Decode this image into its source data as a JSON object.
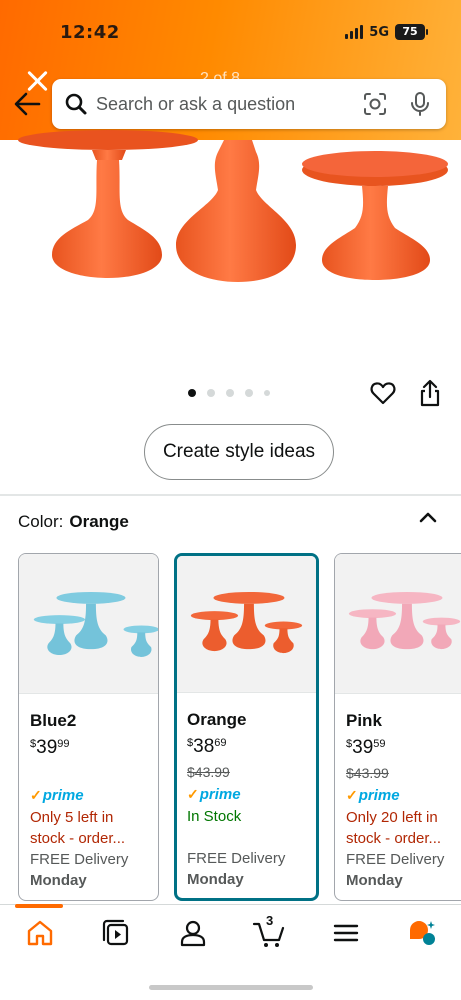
{
  "status_bar": {
    "time": "12:42",
    "network": "5G",
    "battery": "75"
  },
  "header": {
    "page_counter": "2 of 8"
  },
  "search": {
    "placeholder": "Search or ask a question"
  },
  "gallery": {
    "dot_count": 5,
    "active_index": 0
  },
  "actions": {
    "create_style_label": "Create style ideas"
  },
  "variant": {
    "color_label": "Color:",
    "color_value": "Orange"
  },
  "swatches": [
    {
      "name": "Blue2",
      "price_symbol": "$",
      "price_dollars": "39",
      "price_cents": "99",
      "list_price": "",
      "prime": "prime",
      "stock": "Only 5 left in stock - order...",
      "delivery": "FREE Delivery",
      "day": "Monday",
      "color": "#7fcbe0"
    },
    {
      "name": "Orange",
      "price_symbol": "$",
      "price_dollars": "38",
      "price_cents": "69",
      "list_price": "$43.99",
      "prime": "prime",
      "stock": "In Stock",
      "delivery": "FREE Delivery",
      "day": "Monday",
      "color": "#f2673a"
    },
    {
      "name": "Pink",
      "price_symbol": "$",
      "price_dollars": "39",
      "price_cents": "59",
      "list_price": "$43.99",
      "prime": "prime",
      "stock": "Only 20 left in stock - order...",
      "delivery": "FREE Delivery",
      "day": "Monday",
      "color": "#f6b6c3"
    }
  ],
  "bottom_nav": {
    "cart_count": "3"
  },
  "colors": {
    "brand_orange": "#ff6a00",
    "selected_border": "#007185",
    "stock_warning": "#b12704",
    "stock_ok": "#007600",
    "prime_blue": "#00a8e1"
  }
}
